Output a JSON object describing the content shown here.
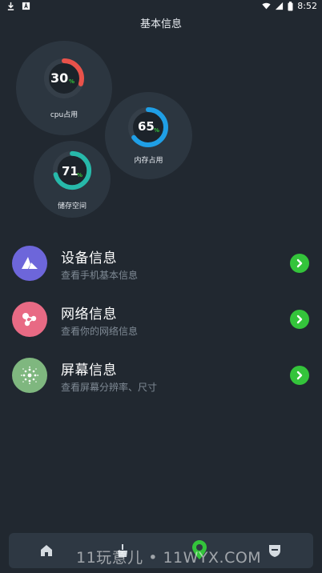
{
  "status_bar": {
    "time": "8:52"
  },
  "header": {
    "title": "基本信息"
  },
  "gauges": [
    {
      "value": "30",
      "unit": "%",
      "label": "cpu占用",
      "percent": 30,
      "color": "#e9524a"
    },
    {
      "value": "65",
      "unit": "%",
      "label": "内存占用",
      "percent": 65,
      "color": "#1f9fe6"
    },
    {
      "value": "71",
      "unit": "%",
      "label": "储存空间",
      "percent": 71,
      "color": "#27b9aa"
    }
  ],
  "items": [
    {
      "title": "设备信息",
      "subtitle": "查看手机基本信息",
      "icon": "triangle-logo-icon",
      "color": "#6d66da"
    },
    {
      "title": "网络信息",
      "subtitle": "查看你的网络信息",
      "icon": "network-nodes-icon",
      "color": "#e86a84"
    },
    {
      "title": "屏幕信息",
      "subtitle": "查看屏幕分辨率、尺寸",
      "icon": "screen-burst-icon",
      "color": "#7fb77f"
    }
  ],
  "nav": {
    "items": [
      "home-icon",
      "cleaner-icon",
      "location-icon",
      "shield-icon"
    ],
    "active_color": "#34c43b"
  },
  "watermark": {
    "text": "11玩意儿 • 11WYX.COM"
  }
}
